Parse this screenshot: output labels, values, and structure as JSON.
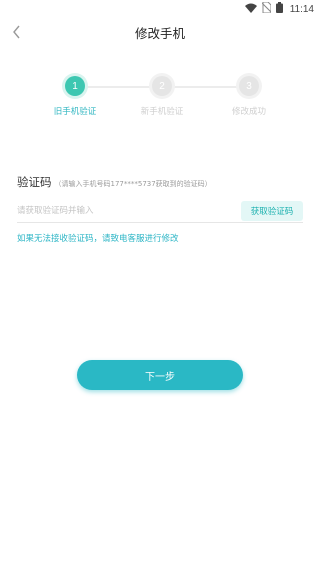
{
  "status_bar": {
    "time": "11:14"
  },
  "nav": {
    "title": "修改手机"
  },
  "steps": [
    {
      "number": "1",
      "label": "旧手机验证",
      "active": true
    },
    {
      "number": "2",
      "label": "新手机验证",
      "active": false
    },
    {
      "number": "3",
      "label": "修改成功",
      "active": false
    }
  ],
  "verify": {
    "title": "验证码",
    "hint": "（请输入手机号码177****5737获取到的验证码）",
    "placeholder": "请获取验证码并输入",
    "get_code_label": "获取验证码",
    "help_text": "如果无法接收验证码，请致电客服进行修改"
  },
  "next_label": "下一步",
  "colors": {
    "accent": "#2ab8c5",
    "step_active": "#3dc7b1",
    "step_inactive": "#e5e5e5"
  }
}
